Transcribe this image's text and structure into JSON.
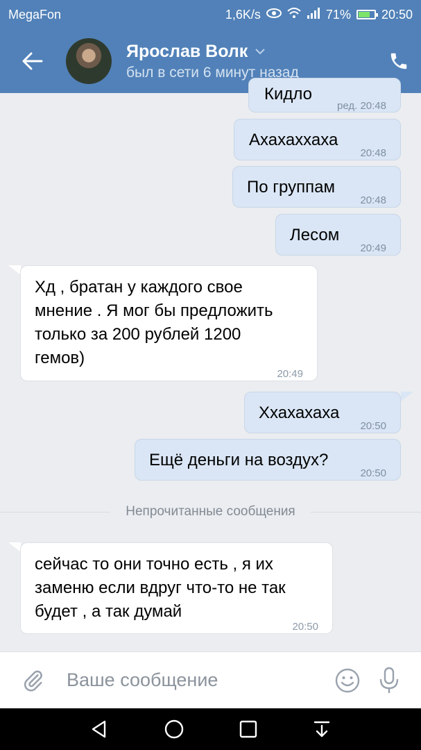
{
  "status_bar": {
    "carrier": "MegaFon",
    "speed": "1,6K/s",
    "battery_percent": "71%",
    "battery_level": 0.71,
    "time": "20:50"
  },
  "header": {
    "name": "Ярослав Волк",
    "last_seen": "был в сети 6 минут назад"
  },
  "messages": [
    {
      "dir": "out",
      "text": "Кидло",
      "time": "ред. 20:48"
    },
    {
      "dir": "out",
      "text": "Ахахаххаха",
      "time": "20:48"
    },
    {
      "dir": "out",
      "text": "По группам",
      "time": "20:48"
    },
    {
      "dir": "out",
      "text": "Лесом",
      "time": "20:49"
    },
    {
      "dir": "in",
      "lines": [
        "Хд , братан у каждого свое",
        "мнение . Я мог бы предложить",
        "только за 200 рублей 1200",
        "гемов)"
      ],
      "time": "20:49"
    },
    {
      "dir": "out",
      "text": "Ххахахаха",
      "time": "20:50"
    },
    {
      "dir": "out",
      "text": "Ещё деньги на воздух?",
      "time": "20:50"
    },
    {
      "dir": "in",
      "lines": [
        "сейчас то они точно есть , я их",
        "заменю если вдруг что-то не так",
        "будет , а так думай"
      ],
      "time": "20:50"
    }
  ],
  "unread_divider": "Непрочитанные сообщения",
  "composer": {
    "placeholder": "Ваше сообщение"
  },
  "colors": {
    "header": "#5181b8",
    "outgoing_bubble": "#dae6f5",
    "incoming_bubble": "#ffffff",
    "background": "#ebedf0"
  },
  "icons": [
    "back-arrow-icon",
    "chevron-down-icon",
    "phone-icon",
    "paperclip-icon",
    "emoji-icon",
    "microphone-icon",
    "nav-back-icon",
    "nav-home-icon",
    "nav-recents-icon",
    "nav-notifications-icon"
  ]
}
